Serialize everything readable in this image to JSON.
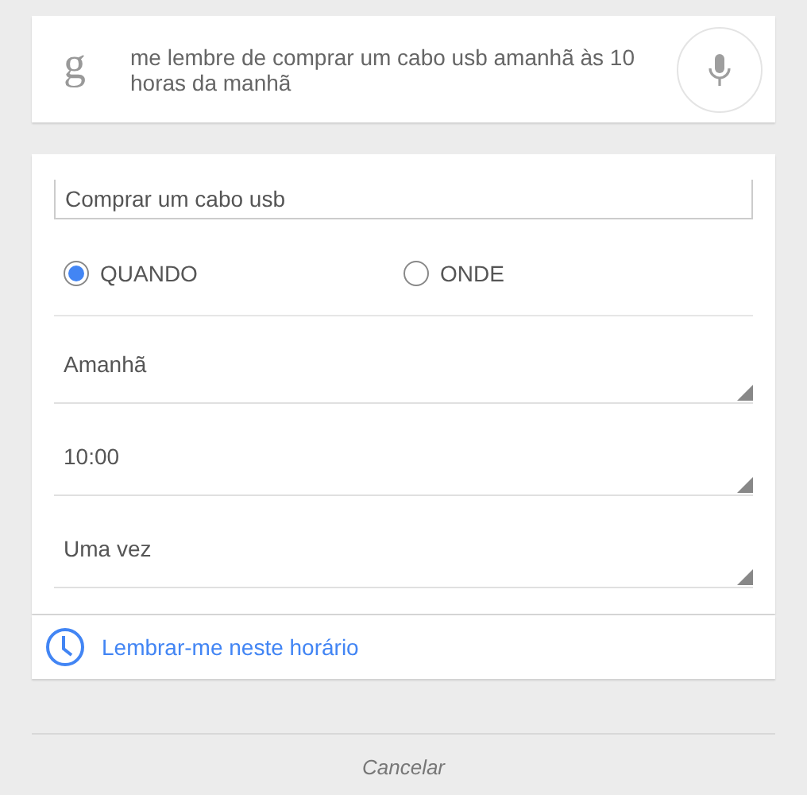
{
  "search": {
    "logo": "g",
    "query": "me lembre de comprar um cabo usb amanhã às 10 horas da manhã"
  },
  "reminder": {
    "title": "Comprar um cabo usb",
    "options": [
      {
        "label": "QUANDO",
        "selected": true
      },
      {
        "label": "ONDE",
        "selected": false
      }
    ],
    "dropdowns": [
      {
        "value": "Amanhã"
      },
      {
        "value": "10:00"
      },
      {
        "value": "Uma vez"
      }
    ],
    "action": "Lembrar-me neste horário"
  },
  "cancel": "Cancelar"
}
